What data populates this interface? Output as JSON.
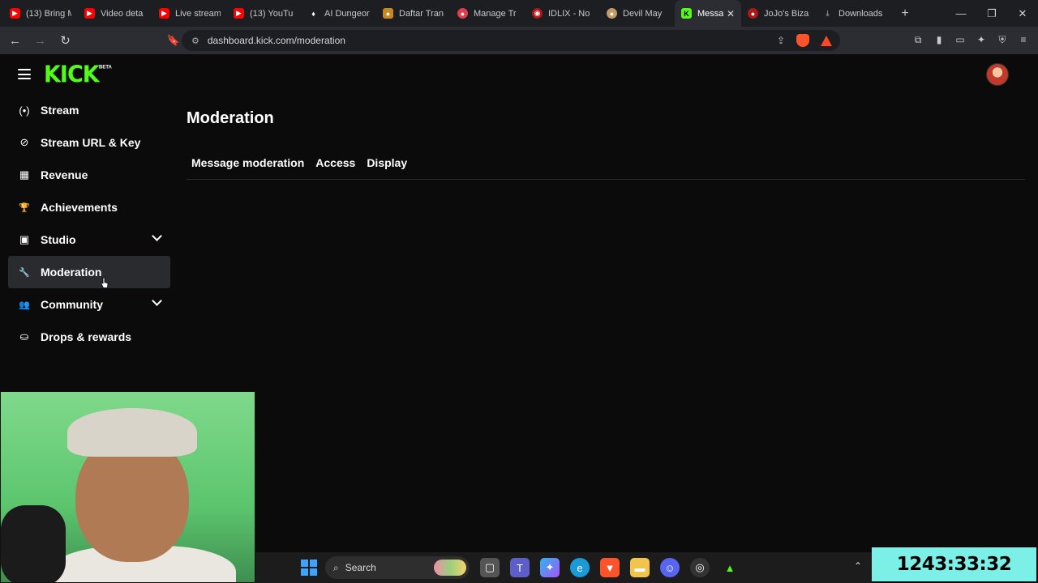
{
  "browser": {
    "tabs": [
      {
        "label": "(13) Bring M",
        "icon": "youtube-icon",
        "color": "#ff0000"
      },
      {
        "label": "Video deta",
        "icon": "youtube-icon",
        "color": "#ff0000"
      },
      {
        "label": "Live stream",
        "icon": "youtube-icon",
        "color": "#ff0000"
      },
      {
        "label": "(13) YouTu",
        "icon": "youtube-icon",
        "color": "#ff0000"
      },
      {
        "label": "AI Dungeon",
        "icon": "flame-icon",
        "color": "#ffffff"
      },
      {
        "label": "Daftar Tran",
        "icon": "pouch-icon",
        "color": "#c8881f"
      },
      {
        "label": "Manage Tr",
        "icon": "tip-icon",
        "color": "#e23d4b"
      },
      {
        "label": "IDLIX - No",
        "icon": "idlix-icon",
        "color": "#b01818"
      },
      {
        "label": "Devil May",
        "icon": "devilmay-icon",
        "color": "#c39b66"
      },
      {
        "label": "Messa",
        "icon": "kick-icon",
        "color": "#53fc18",
        "active": true
      },
      {
        "label": "JoJo's Bizar",
        "icon": "jojo-icon",
        "color": "#b01818"
      },
      {
        "label": "Downloads",
        "icon": "download-icon",
        "color": "#c7c9cf"
      }
    ],
    "url": "dashboard.kick.com/moderation"
  },
  "page": {
    "logo_text": "KICK",
    "logo_badge": "BETA",
    "title": "Moderation",
    "tabs": [
      "Message moderation",
      "Access",
      "Display"
    ]
  },
  "sidebar": {
    "items": [
      {
        "label": "Stream",
        "icon": "broadcast-icon",
        "glyph": "(•)"
      },
      {
        "label": "Stream URL & Key",
        "icon": "link-icon",
        "glyph": "⊘"
      },
      {
        "label": "Revenue",
        "icon": "chart-icon",
        "glyph": "▦"
      },
      {
        "label": "Achievements",
        "icon": "trophy-icon",
        "glyph": "🏆"
      },
      {
        "label": "Studio",
        "icon": "studio-icon",
        "glyph": "▣",
        "expandable": true
      },
      {
        "label": "Moderation",
        "icon": "wrench-icon",
        "glyph": "🔧",
        "active": true
      },
      {
        "label": "Community",
        "icon": "community-icon",
        "glyph": "👥",
        "expandable": true
      },
      {
        "label": "Drops & rewards",
        "icon": "drops-icon",
        "glyph": "⛀"
      }
    ]
  },
  "taskbar": {
    "search_label": "Search"
  },
  "overlay": {
    "timer": "1243:33:32"
  },
  "colors": {
    "accent": "#53fc18",
    "background": "#0b0b0c",
    "timer_bg": "#7cf0e6"
  }
}
